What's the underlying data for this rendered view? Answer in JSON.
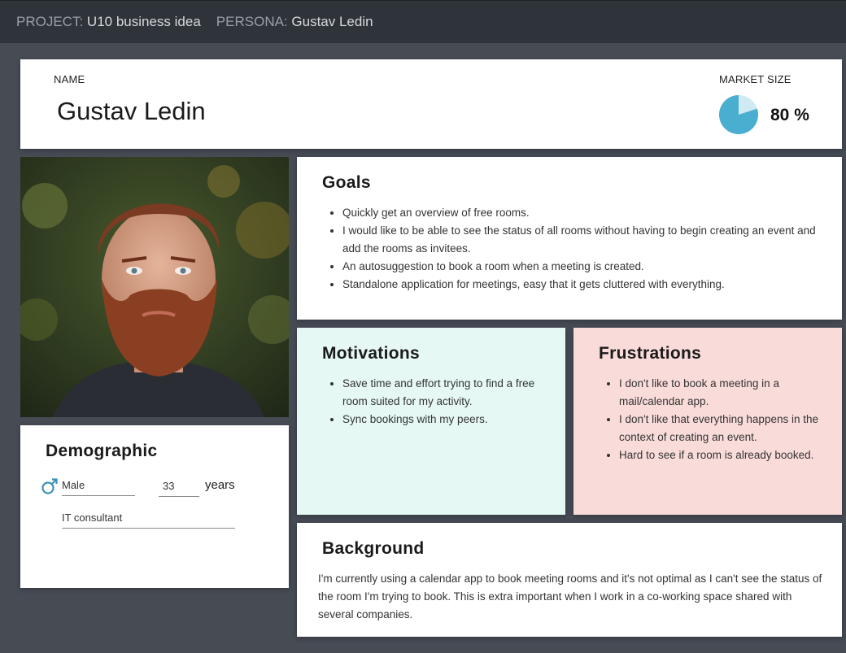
{
  "header": {
    "project_label": "PROJECT:",
    "project_value": "U10 business idea",
    "persona_label": "PERSONA:",
    "persona_value": "Gustav Ledin"
  },
  "profile": {
    "name_label": "NAME",
    "name": "Gustav Ledin",
    "market_label": "MARKET SIZE",
    "market_value": "80 %",
    "market_fraction": 0.8,
    "market_color": "#4aaed0",
    "market_rest_color": "#cfeaf3"
  },
  "photo": {
    "icon": "persona-photo"
  },
  "demographic": {
    "title": "Demographic",
    "gender_icon": "male-icon",
    "gender": "Male",
    "age": "33",
    "age_unit": "years",
    "occupation": "IT consultant"
  },
  "goals": {
    "title": "Goals",
    "items": [
      "Quickly get an overview of free rooms.",
      "I would like to be able to see the status of all rooms without having to begin creating an event and add the rooms as invitees.",
      "An autosuggestion to book a room when a meeting is created.",
      "Standalone application for meetings, easy that it gets cluttered with everything."
    ]
  },
  "motivations": {
    "title": "Motivations",
    "color": "#e6f8f4",
    "items": [
      "Save time and effort trying to find a free room suited for my activity.",
      "Sync bookings with my peers."
    ]
  },
  "frustrations": {
    "title": "Frustrations",
    "color": "#f9dcda",
    "items": [
      "I don't like to book a meeting in a mail/calendar app.",
      "I don't like that everything happens in the context of creating an event.",
      "Hard to see if a room is already booked."
    ]
  },
  "background": {
    "title": "Background",
    "text": "I'm currently using a calendar app to book meeting rooms and it's not optimal as I can't see the status of the room I'm trying to book. This is extra important when I work in a co-working space shared with several companies."
  }
}
